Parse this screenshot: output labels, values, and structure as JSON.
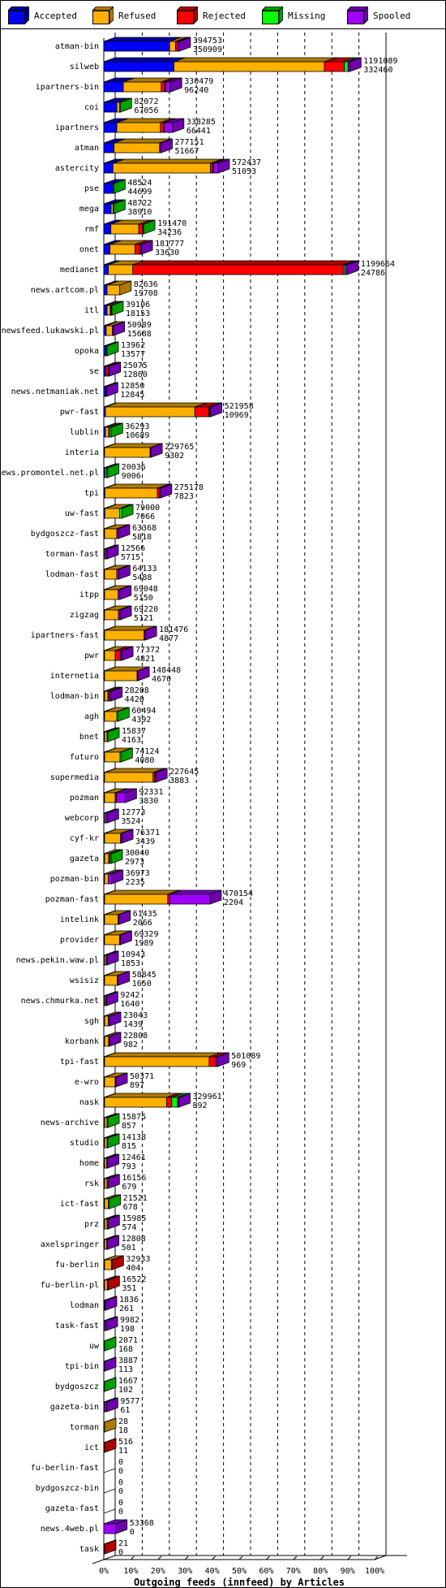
{
  "chart_data": {
    "type": "bar",
    "orientation": "horizontal",
    "stacked": true,
    "style": "3d",
    "title": "Outgoing feeds (innfeed) by Articles",
    "xlabel": "Outgoing feeds (innfeed) by Articles",
    "ylabel": "",
    "x_ticks": [
      "0%",
      "10%",
      "20%",
      "30%",
      "40%",
      "50%",
      "60%",
      "70%",
      "80%",
      "90%",
      "100%"
    ],
    "xlim_percent": [
      0,
      100
    ],
    "scale_max": 1199664,
    "grid": "vertical dashed",
    "legend_position": "top",
    "legend": [
      {
        "name": "Accepted",
        "color": "#0000ff",
        "side": "#00009f"
      },
      {
        "name": "Refused",
        "color": "#ffb000",
        "side": "#b07a00"
      },
      {
        "name": "Rejected",
        "color": "#ff0000",
        "side": "#af0000"
      },
      {
        "name": "Missing",
        "color": "#00ff00",
        "side": "#00a000"
      },
      {
        "name": "Spooled",
        "color": "#a000ff",
        "side": "#7000b0"
      }
    ],
    "rows": [
      {
        "name": "atman-bin",
        "total": 394753,
        "value2": 350909,
        "segments_pct": [
          24.3,
          2.2,
          0.7,
          0,
          0.6
        ]
      },
      {
        "name": "silweb",
        "total": 1191089,
        "value2": 332460,
        "segments_pct": [
          25.9,
          55.5,
          7.4,
          1.4,
          0.6
        ]
      },
      {
        "name": "ipartners-bin",
        "total": 330479,
        "value2": 96240,
        "segments_pct": [
          7.2,
          14.0,
          1.3,
          0.2,
          1.8
        ]
      },
      {
        "name": "coi",
        "total": 82072,
        "value2": 67056,
        "segments_pct": [
          4.8,
          1.0,
          0,
          0.2,
          0
        ]
      },
      {
        "name": "ipartners",
        "total": 338285,
        "value2": 66441,
        "segments_pct": [
          4.8,
          16.1,
          1.2,
          0.1,
          3.0
        ]
      },
      {
        "name": "atman",
        "total": 277151,
        "value2": 51667,
        "segments_pct": [
          3.8,
          16.8,
          0,
          0,
          0.5
        ]
      },
      {
        "name": "astercity",
        "total": 572437,
        "value2": 51053,
        "segments_pct": [
          3.4,
          36.0,
          0.8,
          0.1,
          1.7
        ]
      },
      {
        "name": "pse",
        "total": 48524,
        "value2": 44699,
        "segments_pct": [
          3.4,
          0,
          0,
          0.3,
          0
        ]
      },
      {
        "name": "mega",
        "total": 48722,
        "value2": 38910,
        "segments_pct": [
          2.7,
          0.7,
          0,
          0.3,
          0
        ]
      },
      {
        "name": "rmf",
        "total": 191470,
        "value2": 34236,
        "segments_pct": [
          2.6,
          10.3,
          1.5,
          0.1,
          0
        ]
      },
      {
        "name": "onet",
        "total": 181777,
        "value2": 33630,
        "segments_pct": [
          2.3,
          9.2,
          2.0,
          0,
          0.1
        ]
      },
      {
        "name": "medianet",
        "total": 1199664,
        "value2": 24786,
        "segments_pct": [
          1.7,
          9.0,
          77.7,
          0.6,
          0.8
        ]
      },
      {
        "name": "news.artcom.pl",
        "total": 82636,
        "value2": 19708,
        "segments_pct": [
          1.2,
          4.7,
          0,
          0,
          0
        ]
      },
      {
        "name": "itl",
        "total": 39106,
        "value2": 18153,
        "segments_pct": [
          1.2,
          1.2,
          0.2,
          0.1,
          0
        ]
      },
      {
        "name": "newsfeed.lukawski.pl",
        "total": 50989,
        "value2": 15688,
        "segments_pct": [
          0.9,
          2.3,
          0,
          0,
          0.1
        ]
      },
      {
        "name": "opoka",
        "total": 13962,
        "value2": 13577,
        "segments_pct": [
          0.9,
          0,
          0,
          0.3,
          0
        ]
      },
      {
        "name": "se",
        "total": 25075,
        "value2": 12860,
        "segments_pct": [
          0.7,
          0,
          1.0,
          0,
          0.3
        ]
      },
      {
        "name": "news.netmaniak.net",
        "total": 12850,
        "value2": 12845,
        "segments_pct": [
          0.7,
          0,
          0,
          0,
          0.3
        ]
      },
      {
        "name": "pwr-fast",
        "total": 521958,
        "value2": 10969,
        "segments_pct": [
          0.6,
          33.0,
          5.2,
          0.3,
          0.1
        ]
      },
      {
        "name": "lublin",
        "total": 36293,
        "value2": 10689,
        "segments_pct": [
          0.6,
          1.2,
          0.5,
          0.5,
          0
        ]
      },
      {
        "name": "interia",
        "total": 229765,
        "value2": 9302,
        "segments_pct": [
          0.3,
          16.8,
          0,
          0,
          0.1
        ]
      },
      {
        "name": "news.promontel.net.pl",
        "total": 20036,
        "value2": 9006,
        "segments_pct": [
          0.5,
          0.5,
          0,
          0.4,
          0
        ]
      },
      {
        "name": "tpi",
        "total": 275178,
        "value2": 7823,
        "segments_pct": [
          0.4,
          19.4,
          0.8,
          0,
          0.3
        ]
      },
      {
        "name": "uw-fast",
        "total": 79000,
        "value2": 7066,
        "segments_pct": [
          0.4,
          5.4,
          0,
          0.8,
          0
        ]
      },
      {
        "name": "bydgoszcz-fast",
        "total": 63368,
        "value2": 5818,
        "segments_pct": [
          0.1,
          4.5,
          0,
          0,
          0.6
        ]
      },
      {
        "name": "torman-fast",
        "total": 12566,
        "value2": 5715,
        "segments_pct": [
          0.1,
          0.4,
          0,
          0,
          0.5
        ]
      },
      {
        "name": "lodman-fast",
        "total": 64133,
        "value2": 5488,
        "segments_pct": [
          0.1,
          4.5,
          0,
          0,
          0.7
        ]
      },
      {
        "name": "itpp",
        "total": 69048,
        "value2": 5150,
        "segments_pct": [
          0.1,
          5.0,
          0,
          0,
          0.6
        ]
      },
      {
        "name": "zigzag",
        "total": 69220,
        "value2": 5121,
        "segments_pct": [
          0.1,
          5.1,
          0,
          0,
          0.6
        ]
      },
      {
        "name": "ipartners-fast",
        "total": 181476,
        "value2": 4877,
        "segments_pct": [
          0.1,
          14.6,
          0,
          0,
          0.4
        ]
      },
      {
        "name": "pwr",
        "total": 77372,
        "value2": 4821,
        "segments_pct": [
          0.1,
          3.9,
          1.9,
          0,
          0.5
        ]
      },
      {
        "name": "internetia",
        "total": 148448,
        "value2": 4670,
        "segments_pct": [
          0.1,
          12.0,
          0,
          0,
          0.3
        ]
      },
      {
        "name": "lodman-bin",
        "total": 28208,
        "value2": 4420,
        "segments_pct": [
          0.1,
          1.2,
          0.4,
          0,
          0.7
        ]
      },
      {
        "name": "agh",
        "total": 60494,
        "value2": 4392,
        "segments_pct": [
          0.1,
          4.5,
          0,
          0.4,
          0
        ]
      },
      {
        "name": "bnet",
        "total": 15837,
        "value2": 4163,
        "segments_pct": [
          0.1,
          0.9,
          0,
          0.3,
          0
        ]
      },
      {
        "name": "futuro",
        "total": 74124,
        "value2": 4080,
        "segments_pct": [
          0.1,
          5.7,
          0,
          0.4,
          0
        ]
      },
      {
        "name": "supermedia",
        "total": 227645,
        "value2": 3883,
        "segments_pct": [
          0.1,
          17.9,
          0.7,
          0,
          0.2
        ]
      },
      {
        "name": "pozman",
        "total": 92331,
        "value2": 3830,
        "segments_pct": [
          0.1,
          3.9,
          0.5,
          0,
          3.2
        ]
      },
      {
        "name": "webcorp",
        "total": 12773,
        "value2": 3524,
        "segments_pct": [
          0.1,
          0.5,
          0,
          0,
          0.5
        ]
      },
      {
        "name": "cyf-kr",
        "total": 76371,
        "value2": 3439,
        "segments_pct": [
          0.1,
          5.9,
          0,
          0,
          0.4
        ]
      },
      {
        "name": "gazeta",
        "total": 30040,
        "value2": 2973,
        "segments_pct": [
          0.1,
          1.5,
          0.5,
          0.4,
          0
        ]
      },
      {
        "name": "pozman-bin",
        "total": 36973,
        "value2": 2235,
        "segments_pct": [
          0.1,
          1.4,
          0,
          0,
          1.2
        ]
      },
      {
        "name": "pozman-fast",
        "total": 470154,
        "value2": 2204,
        "segments_pct": [
          0.1,
          23.3,
          0.7,
          0,
          14.9
        ]
      },
      {
        "name": "intelink",
        "total": 61435,
        "value2": 2066,
        "segments_pct": [
          0.1,
          5.0,
          0,
          0,
          0.1
        ]
      },
      {
        "name": "provider",
        "total": 69329,
        "value2": 1989,
        "segments_pct": [
          0.1,
          5.5,
          0,
          0,
          0.2
        ]
      },
      {
        "name": "news.pekin.waw.pl",
        "total": 10943,
        "value2": 1853,
        "segments_pct": [
          0.1,
          0.6,
          0,
          0,
          0.2
        ]
      },
      {
        "name": "wsisiz",
        "total": 58845,
        "value2": 1650,
        "segments_pct": [
          0.1,
          4.7,
          0,
          0,
          0.1
        ]
      },
      {
        "name": "news.chmurka.net",
        "total": 9242,
        "value2": 1640,
        "segments_pct": [
          0.1,
          0.4,
          0,
          0,
          0.3
        ]
      },
      {
        "name": "sgh",
        "total": 23043,
        "value2": 1439,
        "segments_pct": [
          0.1,
          1.4,
          0,
          0,
          0.4
        ]
      },
      {
        "name": "korbank",
        "total": 22808,
        "value2": 982,
        "segments_pct": [
          0.1,
          1.5,
          0,
          0,
          0.3
        ]
      },
      {
        "name": "tpi-fast",
        "total": 501089,
        "value2": 969,
        "segments_pct": [
          0.1,
          38.6,
          2.6,
          0,
          0.5
        ]
      },
      {
        "name": "e-wro",
        "total": 50371,
        "value2": 897,
        "segments_pct": [
          0.1,
          3.9,
          0,
          0,
          0.2
        ]
      },
      {
        "name": "nask",
        "total": 329961,
        "value2": 892,
        "segments_pct": [
          0.1,
          22.9,
          1.9,
          2.1,
          0.5
        ]
      },
      {
        "name": "news-archive",
        "total": 15875,
        "value2": 857,
        "segments_pct": [
          0.1,
          0.9,
          0,
          0.3,
          0
        ]
      },
      {
        "name": "studio",
        "total": 14138,
        "value2": 815,
        "segments_pct": [
          0.1,
          0.9,
          0,
          0.2,
          0
        ]
      },
      {
        "name": "home",
        "total": 12461,
        "value2": 793,
        "segments_pct": [
          0.1,
          0.8,
          0,
          0,
          0.2
        ]
      },
      {
        "name": "rsk",
        "total": 16156,
        "value2": 679,
        "segments_pct": [
          0.1,
          0.9,
          0,
          0,
          0.4
        ]
      },
      {
        "name": "ict-fast",
        "total": 21521,
        "value2": 678,
        "segments_pct": [
          0.1,
          1.4,
          0,
          0.3,
          0
        ]
      },
      {
        "name": "prz",
        "total": 15985,
        "value2": 574,
        "segments_pct": [
          0.1,
          0.9,
          0,
          0,
          0.4
        ]
      },
      {
        "name": "axelspringer",
        "total": 12808,
        "value2": 501,
        "segments_pct": [
          0.1,
          0.8,
          0,
          0,
          0.2
        ]
      },
      {
        "name": "fu-berlin",
        "total": 32933,
        "value2": 404,
        "segments_pct": [
          0.1,
          2.5,
          0.2,
          0,
          0
        ]
      },
      {
        "name": "fu-berlin-pl",
        "total": 16522,
        "value2": 351,
        "segments_pct": [
          0.1,
          1.0,
          0.3,
          0,
          0
        ]
      },
      {
        "name": "lodman",
        "total": 1836,
        "value2": 261,
        "segments_pct": [
          0,
          0.1,
          0,
          0,
          0.1
        ]
      },
      {
        "name": "task-fast",
        "total": 9982,
        "value2": 198,
        "segments_pct": [
          0,
          0.2,
          0,
          0,
          0.6
        ]
      },
      {
        "name": "uw",
        "total": 2071,
        "value2": 168,
        "segments_pct": [
          0,
          0,
          0,
          0.2,
          0
        ]
      },
      {
        "name": "tpi-bin",
        "total": 3887,
        "value2": 113,
        "segments_pct": [
          0,
          0,
          0,
          0,
          0.3
        ]
      },
      {
        "name": "bydgoszcz",
        "total": 1667,
        "value2": 102,
        "segments_pct": [
          0,
          0,
          0,
          0.1,
          0
        ]
      },
      {
        "name": "gazeta-bin",
        "total": 9577,
        "value2": 61,
        "segments_pct": [
          0,
          0.1,
          0,
          0,
          0.7
        ]
      },
      {
        "name": "torman",
        "total": 28,
        "value2": 18,
        "segments_pct": [
          0,
          0.01,
          0,
          0,
          0
        ]
      },
      {
        "name": "ict",
        "total": 516,
        "value2": 11,
        "segments_pct": [
          0,
          0,
          0.04,
          0,
          0
        ]
      },
      {
        "name": "fu-berlin-fast",
        "total": 0,
        "value2": 0,
        "segments_pct": [
          0,
          0,
          0,
          0,
          0
        ]
      },
      {
        "name": "bydgoszcz-bin",
        "total": 0,
        "value2": 0,
        "segments_pct": [
          0,
          0,
          0,
          0,
          0
        ]
      },
      {
        "name": "gazeta-fast",
        "total": 0,
        "value2": 0,
        "segments_pct": [
          0,
          0,
          0,
          0,
          0
        ]
      },
      {
        "name": "news.4web.pl",
        "total": 53368,
        "value2": 0,
        "segments_pct": [
          0,
          0,
          0,
          0,
          4.4
        ]
      },
      {
        "name": "task",
        "total": 21,
        "value2": 0,
        "segments_pct": [
          0,
          0,
          0.002,
          0,
          0
        ]
      }
    ]
  }
}
